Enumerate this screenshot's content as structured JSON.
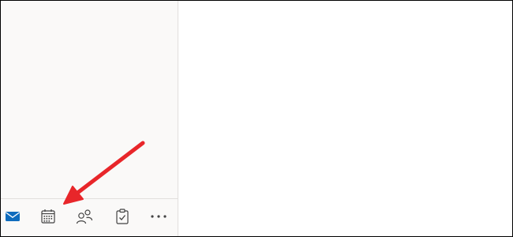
{
  "app": {
    "accent_color": "#0f6cbd",
    "icon_color": "#424242",
    "sidebar_background": "#faf9f8",
    "divider_color": "#e1dfdd"
  },
  "module_bar": {
    "items": [
      {
        "name": "mail",
        "icon": "mail-icon",
        "active": true
      },
      {
        "name": "calendar",
        "icon": "calendar-icon",
        "active": false
      },
      {
        "name": "people",
        "icon": "people-icon",
        "active": false
      },
      {
        "name": "tasks",
        "icon": "clipboard-check-icon",
        "active": false
      },
      {
        "name": "more",
        "icon": "more-horizontal-icon",
        "active": false
      }
    ]
  },
  "annotation": {
    "type": "arrow",
    "color": "#e8262a",
    "points_to": "calendar"
  }
}
